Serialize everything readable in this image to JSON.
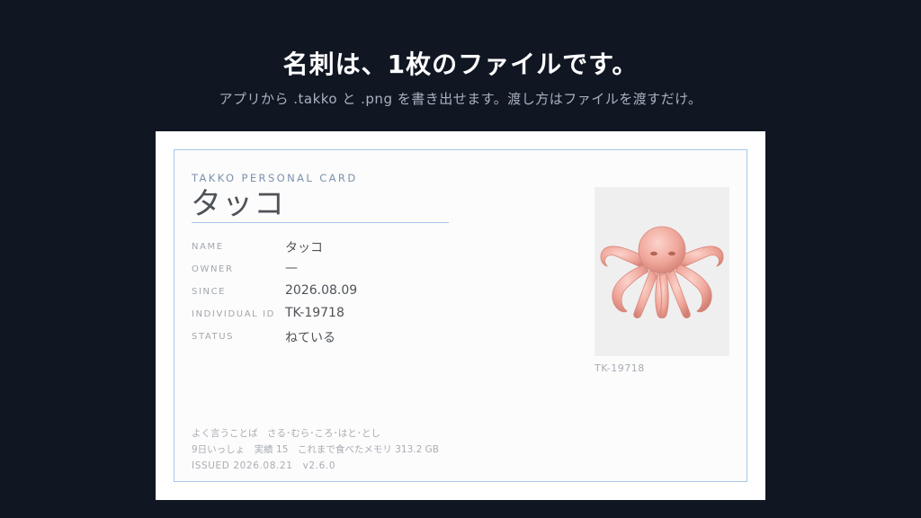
{
  "header": {
    "title": "名刺は、1枚のファイルです。",
    "subtitle": "アプリから .takko と .png を書き出せます。渡し方はファイルを渡すだけ。"
  },
  "card": {
    "kicker": "TAKKO PERSONAL CARD",
    "name": "タッコ",
    "fields": [
      {
        "label": "NAME",
        "value": "タッコ"
      },
      {
        "label": "OWNER",
        "value": "—"
      },
      {
        "label": "SINCE",
        "value": "2026.08.09"
      },
      {
        "label": "INDIVIDUAL ID",
        "value": "TK-19718"
      },
      {
        "label": "STATUS",
        "value": "ねている"
      }
    ],
    "photo_caption": "TK-19718",
    "footer": {
      "words": "よく言うことば　さる･むら･ころ･はと･とし",
      "stats": "9日いっしょ　実績 15　これまで食べたメモリ 313.2 GB",
      "issued": "ISSUED 2026.08.21　v2.6.0"
    }
  },
  "colors": {
    "background": "#111623",
    "card": "#fcfcfc",
    "accent": "#a7c6e6",
    "octopus": "#f0a79b"
  },
  "icons": {
    "photo": "octopus-icon"
  }
}
